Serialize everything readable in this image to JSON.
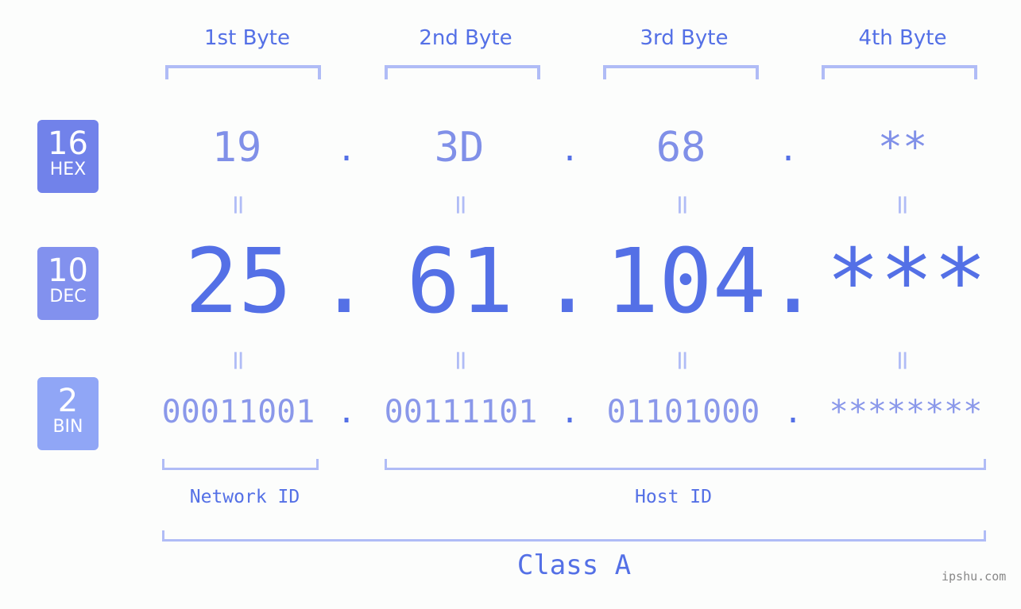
{
  "byte_headers": [
    "1st Byte",
    "2nd Byte",
    "3rd Byte",
    "4th Byte"
  ],
  "badges": {
    "hex": {
      "num": "16",
      "label": "HEX",
      "color": "#7182ea"
    },
    "dec": {
      "num": "10",
      "label": "DEC",
      "color": "#8291ee"
    },
    "bin": {
      "num": "2",
      "label": "BIN",
      "color": "#90a6f6"
    }
  },
  "hex_values": [
    "19",
    "3D",
    "68",
    "**"
  ],
  "dec_values": [
    "25",
    "61",
    "104",
    "***"
  ],
  "bin_values": [
    "00011001",
    "00111101",
    "01101000",
    "********"
  ],
  "separator": ".",
  "equals": "=",
  "network_id_label": "Network ID",
  "host_id_label": "Host ID",
  "class_label": "Class A",
  "watermark": "ipshu.com",
  "colors": {
    "accent": "#5470e6",
    "light": "#b0bcf6"
  }
}
